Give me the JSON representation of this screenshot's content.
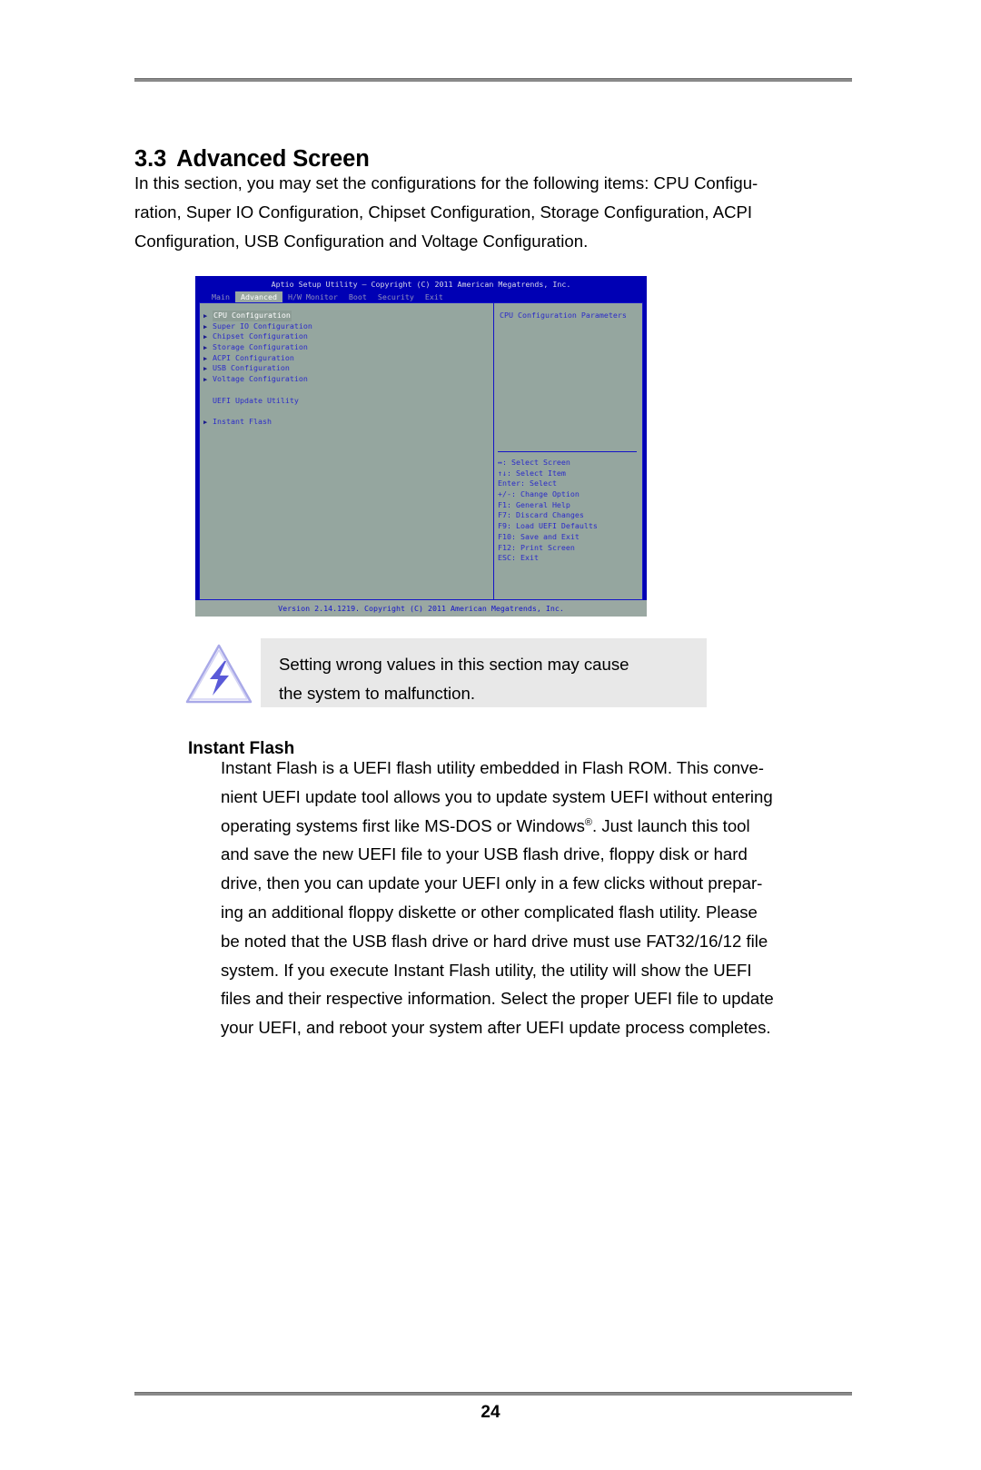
{
  "page": {
    "number": "24"
  },
  "section": {
    "number": "3.3",
    "title": "Advanced Screen",
    "intro_lines": [
      "In this section, you may set the configurations for the following items: CPU Configu-",
      "ration, Super IO Configuration, Chipset Configuration, Storage Configuration, ACPI",
      "Configuration, USB Configuration and Voltage Configuration."
    ]
  },
  "bios": {
    "title": "Aptio Setup Utility – Copyright (C) 2011 American Megatrends, Inc.",
    "tabs": [
      {
        "label": "Main",
        "active": false
      },
      {
        "label": "Advanced",
        "active": true
      },
      {
        "label": "H/W Monitor",
        "active": false
      },
      {
        "label": "Boot",
        "active": false
      },
      {
        "label": "Security",
        "active": false
      },
      {
        "label": "Exit",
        "active": false
      }
    ],
    "menu_items": [
      {
        "label": "CPU Configuration",
        "arrow": true,
        "selected": true
      },
      {
        "label": "Super IO Configuration",
        "arrow": true,
        "selected": false
      },
      {
        "label": "Chipset Configuration",
        "arrow": true,
        "selected": false
      },
      {
        "label": "Storage Configuration",
        "arrow": true,
        "selected": false
      },
      {
        "label": "ACPI Configuration",
        "arrow": true,
        "selected": false
      },
      {
        "label": "USB Configuration",
        "arrow": true,
        "selected": false
      },
      {
        "label": "Voltage Configuration",
        "arrow": true,
        "selected": false
      }
    ],
    "section_label": "UEFI Update Utility",
    "instant_flash_item": {
      "label": "Instant Flash",
      "arrow": true
    },
    "help_text": "CPU Configuration Parameters",
    "key_legend": [
      "↔: Select Screen",
      "↑↓: Select Item",
      "Enter: Select",
      "+/-: Change Option",
      "F1: General Help",
      "F7: Discard Changes",
      "F9: Load UEFI Defaults",
      "F10: Save and Exit",
      "F12: Print Screen",
      "ESC: Exit"
    ],
    "footer": "Version 2.14.1219. Copyright (C) 2011 American Megatrends, Inc.",
    "colors": {
      "title_bar": "#0000b4",
      "panel": "#95a69f",
      "border": "#1414c8",
      "text": "#2b2bc8",
      "tab_active_bg": "#9aa8a2"
    }
  },
  "caution": {
    "icon": "warning-lightning-icon",
    "lines": [
      "Setting wrong values in this section may cause",
      "the system to malfunction."
    ]
  },
  "instant_flash": {
    "heading": "Instant Flash",
    "lines": [
      "Instant Flash is a UEFI flash utility embedded in Flash ROM. This conve-",
      "nient UEFI update tool allows you to update system UEFI without entering",
      "operating systems first like MS-DOS or Windows",
      ". Just launch this tool",
      "and save the new UEFI file to your USB flash drive, floppy disk or hard",
      "drive, then you can update your UEFI only in a few clicks without prepar-",
      "ing an additional floppy diskette or other complicated flash utility. Please",
      "be noted that the USB flash drive or hard drive must use FAT32/16/12 file",
      "system. If you execute Instant Flash utility, the utility will show the UEFI",
      "files and their respective information. Select the proper UEFI file to update",
      "your UEFI, and reboot your system after UEFI update process completes."
    ],
    "registered_mark": "®"
  }
}
